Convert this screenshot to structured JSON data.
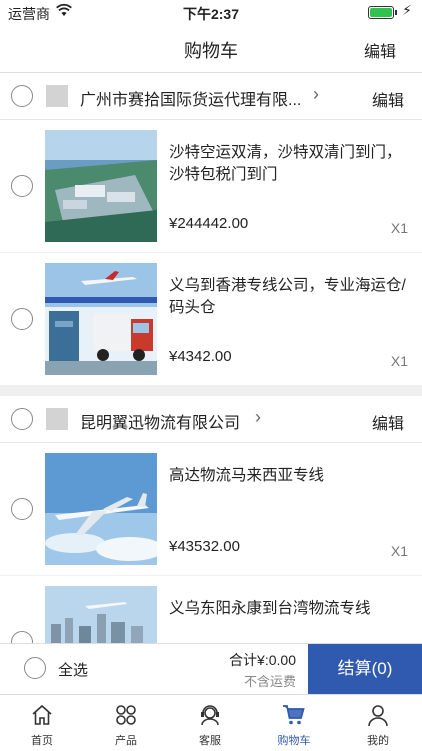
{
  "status_bar": {
    "carrier": "运营商",
    "time": "下午2:37"
  },
  "nav": {
    "title": "购物车",
    "edit": "编辑"
  },
  "shops": [
    {
      "name": "广州市赛拾国际货运代理有限...",
      "edit": "编辑",
      "items": [
        {
          "name": "沙特空运双清，沙特双清门到门，沙特包税门到门",
          "price": "¥244442.00",
          "qty": "X1"
        },
        {
          "name": "义乌到香港专线公司，专业海运仓/码头仓",
          "price": "¥4342.00",
          "qty": "X1"
        }
      ]
    },
    {
      "name": "昆明翼迅物流有限公司",
      "edit": "编辑",
      "items": [
        {
          "name": "高达物流马来西亚专线",
          "price": "¥43532.00",
          "qty": "X1"
        },
        {
          "name": "义乌东阳永康到台湾物流专线",
          "price": "",
          "qty": ""
        }
      ]
    }
  ],
  "checkout": {
    "select_all": "全选",
    "total": "合计¥:0.00",
    "shipping_note": "不含运费",
    "pay_button": "结算(0)"
  },
  "tabs": [
    {
      "label": "首页",
      "icon": "home-icon"
    },
    {
      "label": "产品",
      "icon": "products-icon"
    },
    {
      "label": "客服",
      "icon": "customer-service-icon"
    },
    {
      "label": "购物车",
      "icon": "cart-icon",
      "active": true
    },
    {
      "label": "我的",
      "icon": "profile-icon"
    }
  ],
  "colors": {
    "accent": "#2f5ab0",
    "battery": "#30c44e"
  }
}
